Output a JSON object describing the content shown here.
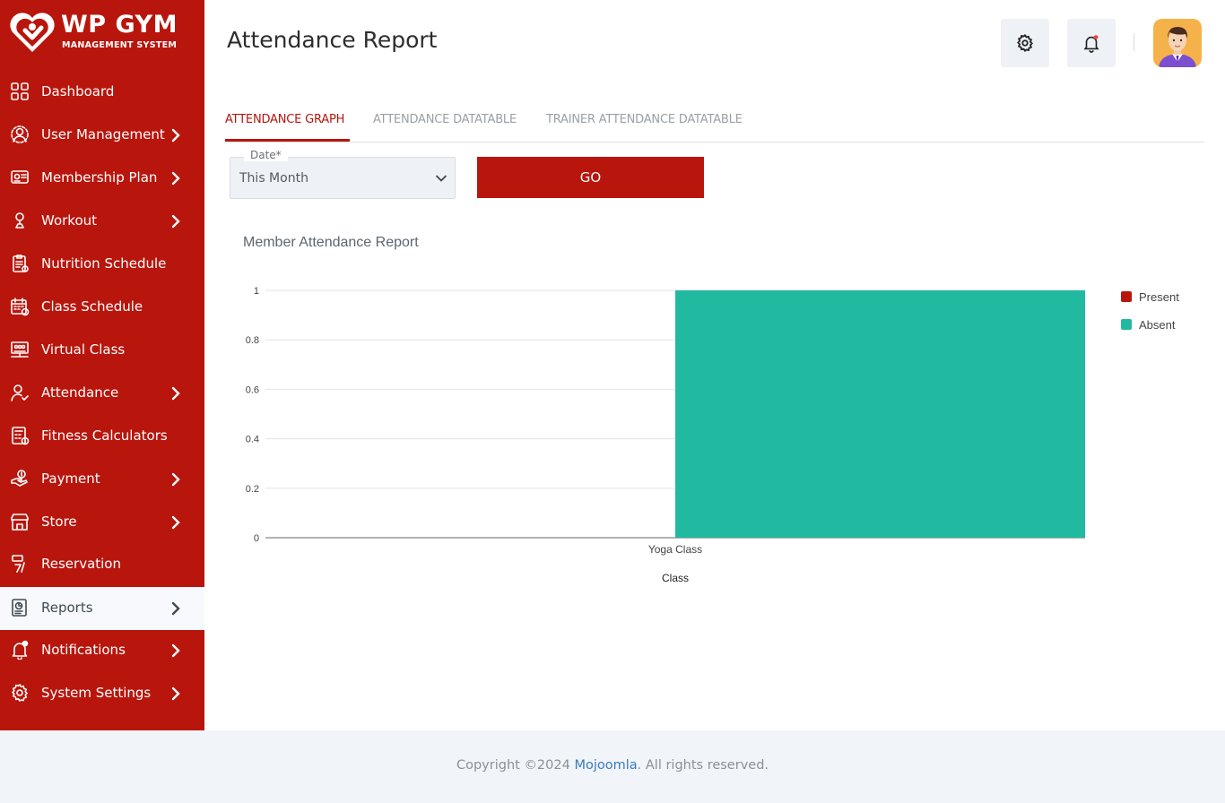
{
  "brand": {
    "title": "WP GYM",
    "subtitle": "MANAGEMENT SYSTEM"
  },
  "sidebar": {
    "items": [
      {
        "label": "Dashboard",
        "icon": "dashboard-icon",
        "has_submenu": false
      },
      {
        "label": "User Management",
        "icon": "users-gear-icon",
        "has_submenu": true
      },
      {
        "label": "Membership Plan",
        "icon": "membership-card-icon",
        "has_submenu": true
      },
      {
        "label": "Workout",
        "icon": "workout-icon",
        "has_submenu": true
      },
      {
        "label": "Nutrition Schedule",
        "icon": "nutrition-clipboard-icon",
        "has_submenu": false
      },
      {
        "label": "Class Schedule",
        "icon": "calendar-icon",
        "has_submenu": false
      },
      {
        "label": "Virtual Class",
        "icon": "virtual-class-icon",
        "has_submenu": false
      },
      {
        "label": "Attendance",
        "icon": "attendance-user-icon",
        "has_submenu": true
      },
      {
        "label": "Fitness Calculators",
        "icon": "calculator-icon",
        "has_submenu": false
      },
      {
        "label": "Payment",
        "icon": "payment-hand-icon",
        "has_submenu": true
      },
      {
        "label": "Store",
        "icon": "store-icon",
        "has_submenu": true
      },
      {
        "label": "Reservation",
        "icon": "reservation-icon",
        "has_submenu": false
      },
      {
        "label": "Reports",
        "icon": "reports-icon",
        "has_submenu": true,
        "active": true
      },
      {
        "label": "Notifications",
        "icon": "bell-icon",
        "has_submenu": true
      },
      {
        "label": "System Settings",
        "icon": "gear-icon",
        "has_submenu": true
      }
    ]
  },
  "header": {
    "title": "Attendance Report"
  },
  "tabs": [
    {
      "label": "ATTENDANCE GRAPH",
      "active": true
    },
    {
      "label": "ATTENDANCE DATATABLE",
      "active": false
    },
    {
      "label": "TRAINER ATTENDANCE DATATABLE",
      "active": false
    }
  ],
  "filter": {
    "date_label": "Date*",
    "date_value": "This Month",
    "go_label": "GO"
  },
  "chart_data": {
    "type": "bar",
    "title": "Member Attendance Report",
    "xlabel": "Class",
    "ylabel": "",
    "categories": [
      "Yoga Class"
    ],
    "series": [
      {
        "name": "Present",
        "values": [
          0
        ],
        "color": "#b8160d"
      },
      {
        "name": "Absent",
        "values": [
          1
        ],
        "color": "#22b9a1"
      }
    ],
    "ylim": [
      0,
      1
    ],
    "yticks": [
      "0",
      "0.2",
      "0.4",
      "0.6",
      "0.8",
      "1"
    ],
    "grid": true,
    "legend": "right"
  },
  "footer": {
    "prefix": "Copyright ©2024 ",
    "link": "Mojoomla",
    "suffix": ". All rights reserved."
  },
  "colors": {
    "brand": "#b8160d",
    "accent": "#22b9a1",
    "active_bg": "#f7f9fc"
  }
}
